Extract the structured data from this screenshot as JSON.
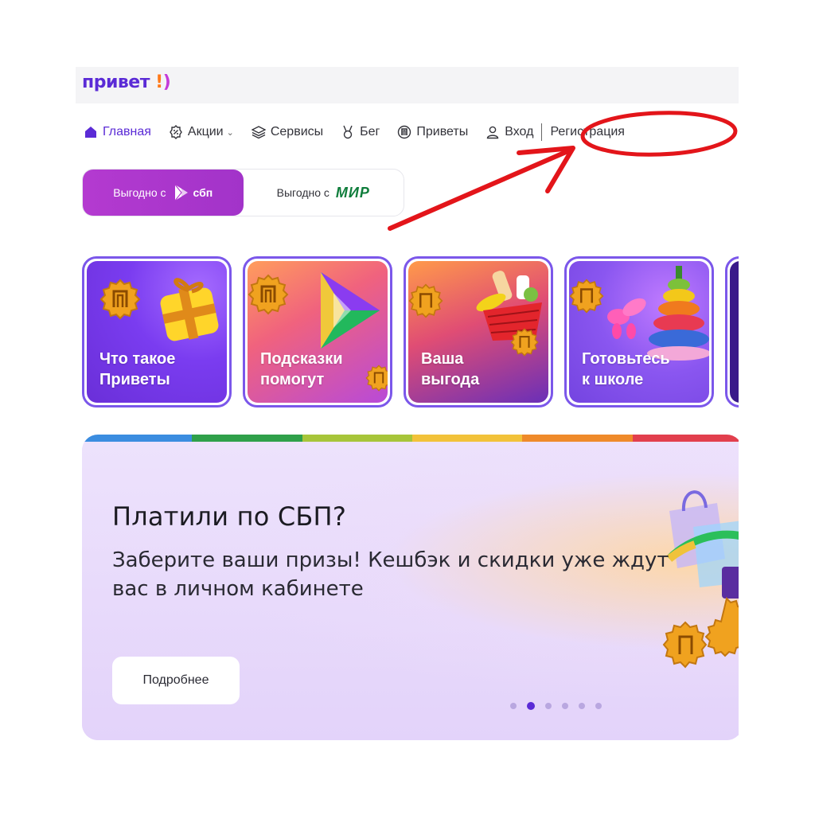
{
  "logo": {
    "text": "привет",
    "accent": "!",
    "accent2": ")"
  },
  "nav": {
    "items": [
      {
        "label": "Главная",
        "icon": "home-icon"
      },
      {
        "label": "Акции",
        "icon": "discount-icon"
      },
      {
        "label": "Сервисы",
        "icon": "layers-icon"
      },
      {
        "label": "Бег",
        "icon": "medal-icon"
      },
      {
        "label": "Приветы",
        "icon": "coin-icon"
      }
    ],
    "login": "Вход",
    "register": "Регистрация"
  },
  "promo_toggle": {
    "active_label": "Выгодно с",
    "active_brand": "сбп",
    "inactive_label": "Выгодно с",
    "inactive_brand": "МИР"
  },
  "stories": [
    {
      "title": "Что такое\nПриветы"
    },
    {
      "title": "Подсказки\nпомогут"
    },
    {
      "title": "Ваша\nвыгода"
    },
    {
      "title": "Готовьтесь\nк школе"
    }
  ],
  "banner": {
    "title": "Платили по СБП?",
    "subtitle": "Заберите ваши призы! Кешбэк и скидки уже ждут вас в личном кабинете",
    "button": "Подробнее",
    "slides_count": 6,
    "active_slide": 2
  },
  "colors": {
    "brand": "#5b2bd6",
    "sbp_gradient": "#b43ad0",
    "mir_green": "#0f7d3b",
    "annotation_red": "#e3151a"
  }
}
